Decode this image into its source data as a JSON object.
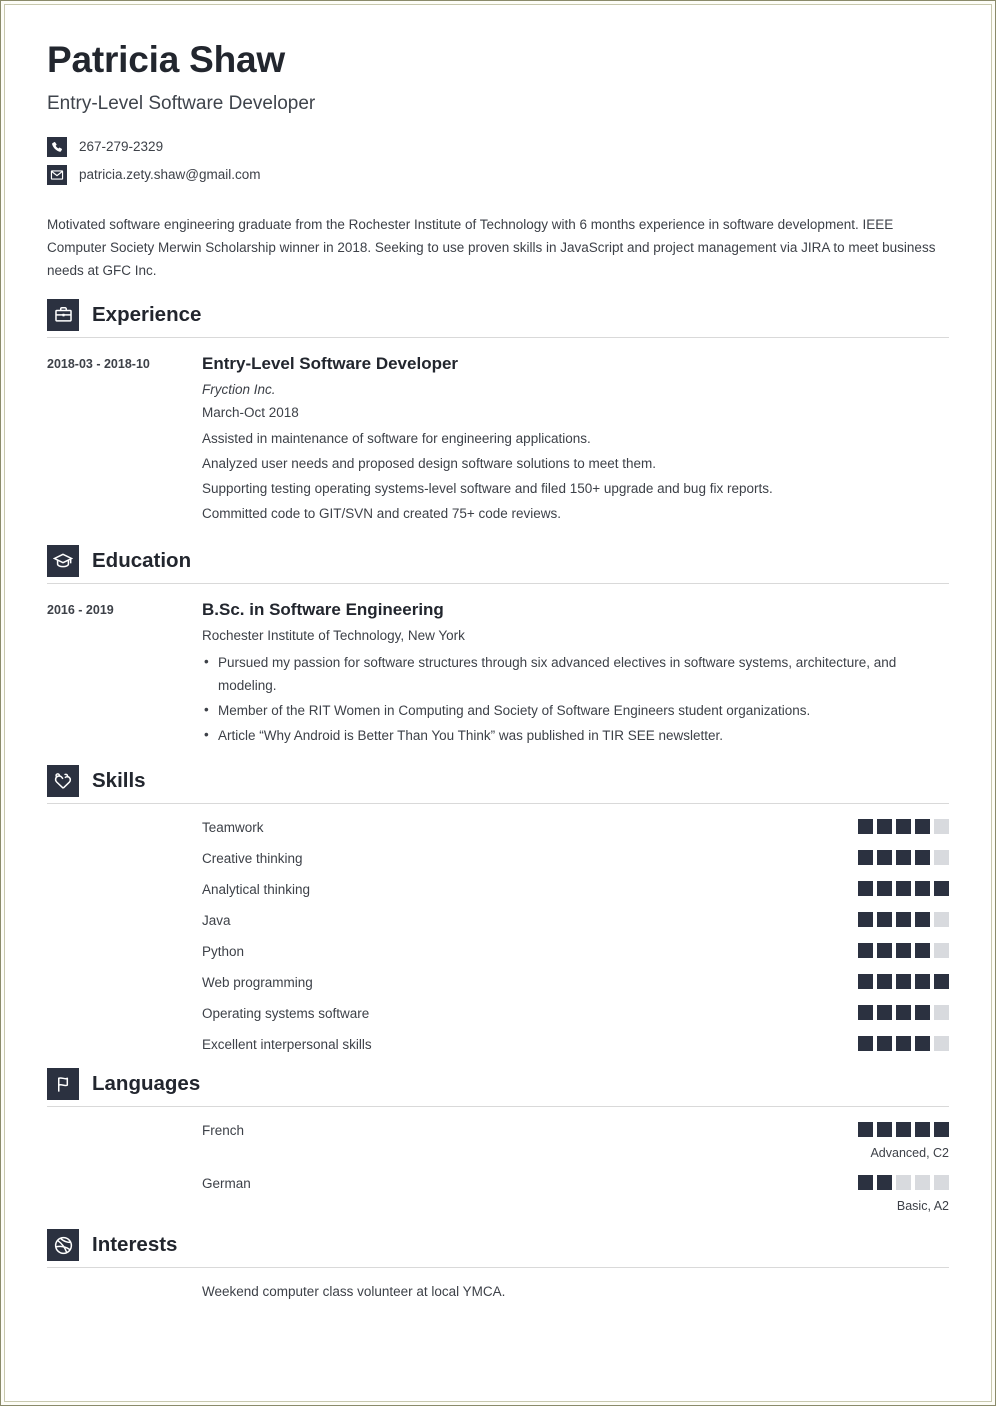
{
  "theme": {
    "accent": "#2b3140",
    "dot_on": "#2b3140",
    "dot_off": "#d8dade",
    "text": "#3d4148"
  },
  "header": {
    "name": "Patricia Shaw",
    "job_title": "Entry-Level Software Developer",
    "contacts": [
      {
        "icon": "phone-icon",
        "value": "267-279-2329"
      },
      {
        "icon": "email-icon",
        "value": "patricia.zety.shaw@gmail.com"
      }
    ]
  },
  "summary": "Motivated software engineering graduate from the Rochester Institute of Technology with 6 months experience in software development. IEEE Computer Society Merwin Scholarship winner in 2018. Seeking to use proven skills in JavaScript and project management via JIRA to meet business needs at GFC Inc.",
  "sections": {
    "experience": {
      "title": "Experience",
      "icon": "briefcase-icon",
      "entries": [
        {
          "date": "2018-03 - 2018-10",
          "title": "Entry-Level Software Developer",
          "company": "Fryction Inc.",
          "period": "March-Oct 2018",
          "lines": [
            "Assisted in maintenance of software for engineering applications.",
            "Analyzed user needs and proposed design software solutions to meet them.",
            "Supporting testing operating systems-level software and filed 150+ upgrade and bug fix reports.",
            "Committed code to GIT/SVN and created 75+ code reviews."
          ]
        }
      ]
    },
    "education": {
      "title": "Education",
      "icon": "graduation-cap-icon",
      "entries": [
        {
          "date": "2016 - 2019",
          "title": "B.Sc. in Software Engineering",
          "school": "Rochester Institute of Technology, New York",
          "bullets": [
            "Pursued my passion for software structures through six advanced electives in software systems, architecture, and modeling.",
            "Member of the RIT Women in Computing and Society of Software Engineers student organizations.",
            "Article “Why Android is Better Than You Think” was published in TIR SEE newsletter."
          ]
        }
      ]
    },
    "skills": {
      "title": "Skills",
      "icon": "puzzle-heart-icon",
      "max": 5,
      "items": [
        {
          "label": "Teamwork",
          "rating": 4
        },
        {
          "label": "Creative thinking",
          "rating": 4
        },
        {
          "label": "Analytical thinking",
          "rating": 5
        },
        {
          "label": "Java",
          "rating": 4
        },
        {
          "label": "Python",
          "rating": 4
        },
        {
          "label": "Web programming",
          "rating": 5
        },
        {
          "label": "Operating systems software",
          "rating": 4
        },
        {
          "label": "Excellent interpersonal skills",
          "rating": 4
        }
      ]
    },
    "languages": {
      "title": "Languages",
      "icon": "flag-icon",
      "max": 5,
      "items": [
        {
          "label": "French",
          "rating": 5,
          "level": "Advanced, C2"
        },
        {
          "label": "German",
          "rating": 2,
          "level": "Basic, A2"
        }
      ]
    },
    "interests": {
      "title": "Interests",
      "icon": "ball-icon",
      "items": [
        {
          "label": "Weekend computer class volunteer at local YMCA."
        }
      ]
    }
  }
}
